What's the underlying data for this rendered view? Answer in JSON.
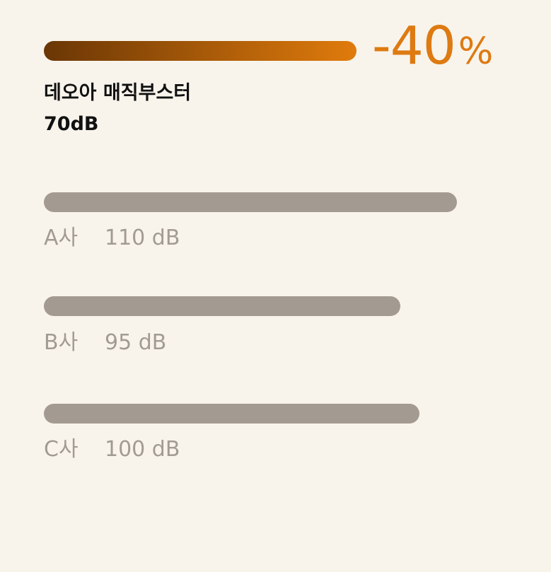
{
  "chart_data": {
    "type": "bar",
    "featured": {
      "name": "데오아 매직부스터",
      "value_label": "70dB",
      "value": 70,
      "reduction_number": "-40",
      "reduction_unit": "%"
    },
    "competitors": [
      {
        "name": "A사",
        "value_label": "110 dB",
        "value": 110
      },
      {
        "name": "B사",
        "value_label": "95 dB",
        "value": 95
      },
      {
        "name": "C사",
        "value_label": "100 dB",
        "value": 100
      }
    ],
    "xlim": [
      0,
      110
    ]
  },
  "colors": {
    "featured_gradient_start": "#6a3605",
    "featured_gradient_end": "#e07b0c",
    "accent": "#de7a12",
    "competitor_bar": "#a39b91",
    "background": "#f8f4ec"
  }
}
